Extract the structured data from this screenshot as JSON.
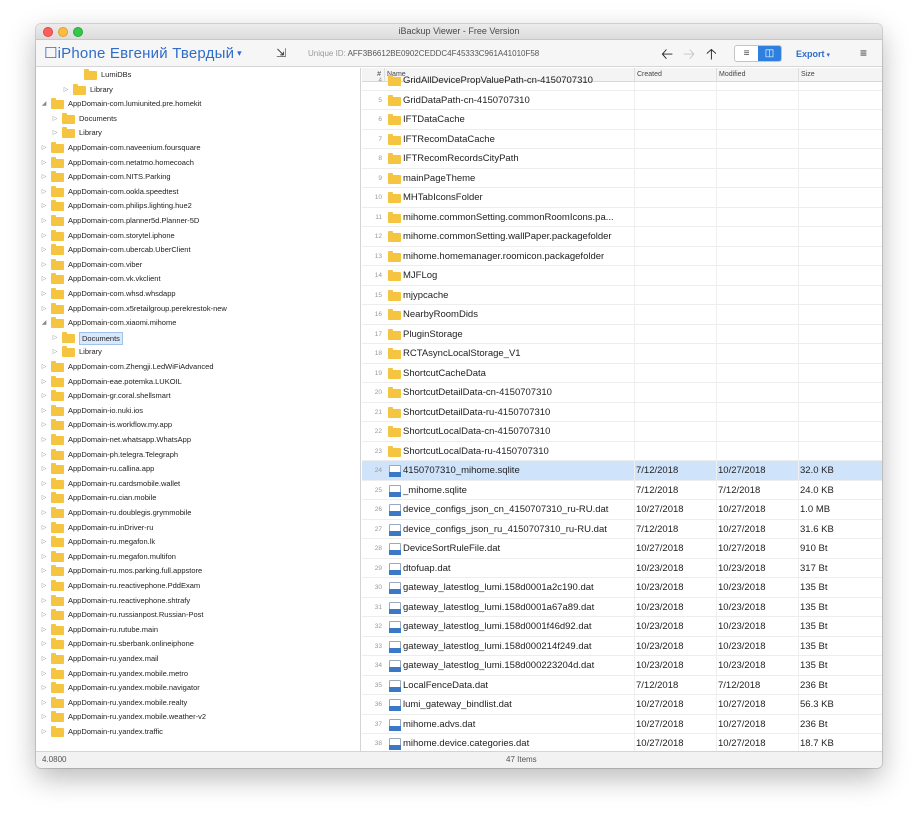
{
  "window": {
    "title": "iBackup Viewer - Free Version"
  },
  "toolbar": {
    "device_name": "☐iPhone Евгений Твердый",
    "device_caret": "▾",
    "tree_icon": "⇲",
    "unique_id_label": "Unique ID:",
    "unique_id_value": "AFF3B6612BE0902CEDDC4F45333C961A41010F58",
    "back": "🡠",
    "forward": "🡢",
    "up": "🡡",
    "view_list": "≡",
    "view_columns": "◫",
    "export_label": "Export",
    "export_caret": "▾",
    "menu": "≡"
  },
  "sidebar": {
    "items": [
      {
        "label": "LumiDBs",
        "level": 3,
        "disclosure": ""
      },
      {
        "label": "Library",
        "level": 2,
        "disclosure": "closed"
      },
      {
        "label": "AppDomain-com.lumiunited.pre.homekit",
        "level": 0,
        "disclosure": "open"
      },
      {
        "label": "Documents",
        "level": 1,
        "disclosure": "closed"
      },
      {
        "label": "Library",
        "level": 1,
        "disclosure": "closed"
      },
      {
        "label": "AppDomain-com.naveenium.foursquare",
        "level": 0,
        "disclosure": "closed"
      },
      {
        "label": "AppDomain-com.netatmo.homecoach",
        "level": 0,
        "disclosure": "closed"
      },
      {
        "label": "AppDomain-com.NITS.Parking",
        "level": 0,
        "disclosure": "closed"
      },
      {
        "label": "AppDomain-com.ookla.speedtest",
        "level": 0,
        "disclosure": "closed"
      },
      {
        "label": "AppDomain-com.philips.lighting.hue2",
        "level": 0,
        "disclosure": "closed"
      },
      {
        "label": "AppDomain-com.planner5d.Planner-5D",
        "level": 0,
        "disclosure": "closed"
      },
      {
        "label": "AppDomain-com.storytel.iphone",
        "level": 0,
        "disclosure": "closed"
      },
      {
        "label": "AppDomain-com.ubercab.UberClient",
        "level": 0,
        "disclosure": "closed"
      },
      {
        "label": "AppDomain-com.viber",
        "level": 0,
        "disclosure": "closed"
      },
      {
        "label": "AppDomain-com.vk.vkclient",
        "level": 0,
        "disclosure": "closed"
      },
      {
        "label": "AppDomain-com.whsd.whsdapp",
        "level": 0,
        "disclosure": "closed"
      },
      {
        "label": "AppDomain-com.x5retailgroup.perekrestok-new",
        "level": 0,
        "disclosure": "closed"
      },
      {
        "label": "AppDomain-com.xiaomi.mihome",
        "level": 0,
        "disclosure": "open"
      },
      {
        "label": "Documents",
        "level": 1,
        "disclosure": "closed",
        "selected": true
      },
      {
        "label": "Library",
        "level": 1,
        "disclosure": "closed"
      },
      {
        "label": "AppDomain-com.Zhengji.LedWiFiAdvanced",
        "level": 0,
        "disclosure": "closed"
      },
      {
        "label": "AppDomain-eae.potemka.LUKOIL",
        "level": 0,
        "disclosure": "closed"
      },
      {
        "label": "AppDomain-gr.coral.shellsmart",
        "level": 0,
        "disclosure": "closed"
      },
      {
        "label": "AppDomain-io.nuki.ios",
        "level": 0,
        "disclosure": "closed"
      },
      {
        "label": "AppDomain-is.workflow.my.app",
        "level": 0,
        "disclosure": "closed"
      },
      {
        "label": "AppDomain-net.whatsapp.WhatsApp",
        "level": 0,
        "disclosure": "closed"
      },
      {
        "label": "AppDomain-ph.telegra.Telegraph",
        "level": 0,
        "disclosure": "closed"
      },
      {
        "label": "AppDomain-ru.callina.app",
        "level": 0,
        "disclosure": "closed"
      },
      {
        "label": "AppDomain-ru.cardsmobile.wallet",
        "level": 0,
        "disclosure": "closed"
      },
      {
        "label": "AppDomain-ru.cian.mobile",
        "level": 0,
        "disclosure": "closed"
      },
      {
        "label": "AppDomain-ru.doublegis.grymmobile",
        "level": 0,
        "disclosure": "closed"
      },
      {
        "label": "AppDomain-ru.inDriver-ru",
        "level": 0,
        "disclosure": "closed"
      },
      {
        "label": "AppDomain-ru.megafon.lk",
        "level": 0,
        "disclosure": "closed"
      },
      {
        "label": "AppDomain-ru.megafon.multifon",
        "level": 0,
        "disclosure": "closed"
      },
      {
        "label": "AppDomain-ru.mos.parking.full.appstore",
        "level": 0,
        "disclosure": "closed"
      },
      {
        "label": "AppDomain-ru.reactivephone.PddExam",
        "level": 0,
        "disclosure": "closed"
      },
      {
        "label": "AppDomain-ru.reactivephone.shtrafy",
        "level": 0,
        "disclosure": "closed"
      },
      {
        "label": "AppDomain-ru.russianpost.Russian-Post",
        "level": 0,
        "disclosure": "closed"
      },
      {
        "label": "AppDomain-ru.rutube.main",
        "level": 0,
        "disclosure": "closed"
      },
      {
        "label": "AppDomain-ru.sberbank.onlineiphone",
        "level": 0,
        "disclosure": "closed"
      },
      {
        "label": "AppDomain-ru.yandex.mail",
        "level": 0,
        "disclosure": "closed"
      },
      {
        "label": "AppDomain-ru.yandex.mobile.metro",
        "level": 0,
        "disclosure": "closed"
      },
      {
        "label": "AppDomain-ru.yandex.mobile.navigator",
        "level": 0,
        "disclosure": "closed"
      },
      {
        "label": "AppDomain-ru.yandex.mobile.realty",
        "level": 0,
        "disclosure": "closed"
      },
      {
        "label": "AppDomain-ru.yandex.mobile.weather-v2",
        "level": 0,
        "disclosure": "closed"
      },
      {
        "label": "AppDomain-ru.yandex.traffic",
        "level": 0,
        "disclosure": "closed"
      }
    ]
  },
  "table": {
    "headers": {
      "num": "#",
      "name": "Name",
      "created": "Created",
      "modified": "Modified",
      "size": "Size"
    },
    "rows": [
      {
        "num": "4",
        "type": "folder",
        "name": "GridAllDevicePropValuePath-cn-4150707310",
        "created": "",
        "modified": "",
        "size": ""
      },
      {
        "num": "5",
        "type": "folder",
        "name": "GridDataPath-cn-4150707310",
        "created": "",
        "modified": "",
        "size": ""
      },
      {
        "num": "6",
        "type": "folder",
        "name": "IFTDataCache",
        "created": "",
        "modified": "",
        "size": ""
      },
      {
        "num": "7",
        "type": "folder",
        "name": "IFTRecomDataCache",
        "created": "",
        "modified": "",
        "size": ""
      },
      {
        "num": "8",
        "type": "folder",
        "name": "IFTRecomRecordsCityPath",
        "created": "",
        "modified": "",
        "size": ""
      },
      {
        "num": "9",
        "type": "folder",
        "name": "mainPageTheme",
        "created": "",
        "modified": "",
        "size": ""
      },
      {
        "num": "10",
        "type": "folder",
        "name": "MHTabIconsFolder",
        "created": "",
        "modified": "",
        "size": ""
      },
      {
        "num": "11",
        "type": "folder",
        "name": "mihome.commonSetting.commonRoomIcons.pa...",
        "created": "",
        "modified": "",
        "size": ""
      },
      {
        "num": "12",
        "type": "folder",
        "name": "mihome.commonSetting.wallPaper.packagefolder",
        "created": "",
        "modified": "",
        "size": ""
      },
      {
        "num": "13",
        "type": "folder",
        "name": "mihome.homemanager.roomicon.packagefolder",
        "created": "",
        "modified": "",
        "size": ""
      },
      {
        "num": "14",
        "type": "folder",
        "name": "MJFLog",
        "created": "",
        "modified": "",
        "size": ""
      },
      {
        "num": "15",
        "type": "folder",
        "name": "mjypcache",
        "created": "",
        "modified": "",
        "size": ""
      },
      {
        "num": "16",
        "type": "folder",
        "name": "NearbyRoomDids",
        "created": "",
        "modified": "",
        "size": ""
      },
      {
        "num": "17",
        "type": "folder",
        "name": "PluginStorage",
        "created": "",
        "modified": "",
        "size": ""
      },
      {
        "num": "18",
        "type": "folder",
        "name": "RCTAsyncLocalStorage_V1",
        "created": "",
        "modified": "",
        "size": ""
      },
      {
        "num": "19",
        "type": "folder",
        "name": "ShortcutCacheData",
        "created": "",
        "modified": "",
        "size": ""
      },
      {
        "num": "20",
        "type": "folder",
        "name": "ShortcutDetailData-cn-4150707310",
        "created": "",
        "modified": "",
        "size": ""
      },
      {
        "num": "21",
        "type": "folder",
        "name": "ShortcutDetailData-ru-4150707310",
        "created": "",
        "modified": "",
        "size": ""
      },
      {
        "num": "22",
        "type": "folder",
        "name": "ShortcutLocalData-cn-4150707310",
        "created": "",
        "modified": "",
        "size": ""
      },
      {
        "num": "23",
        "type": "folder",
        "name": "ShortcutLocalData-ru-4150707310",
        "created": "",
        "modified": "",
        "size": ""
      },
      {
        "num": "24",
        "type": "file",
        "name": "4150707310_mihome.sqlite",
        "created": "7/12/2018",
        "modified": "10/27/2018",
        "size": "32.0 KB",
        "selected": true
      },
      {
        "num": "25",
        "type": "file",
        "name": "_mihome.sqlite",
        "created": "7/12/2018",
        "modified": "7/12/2018",
        "size": "24.0 KB"
      },
      {
        "num": "26",
        "type": "file",
        "name": "device_configs_json_cn_4150707310_ru-RU.dat",
        "created": "10/27/2018",
        "modified": "10/27/2018",
        "size": "1.0 MB"
      },
      {
        "num": "27",
        "type": "file",
        "name": "device_configs_json_ru_4150707310_ru-RU.dat",
        "created": "7/12/2018",
        "modified": "10/27/2018",
        "size": "31.6 KB"
      },
      {
        "num": "28",
        "type": "file",
        "name": "DeviceSortRuleFile.dat",
        "created": "10/27/2018",
        "modified": "10/27/2018",
        "size": "910 Bt"
      },
      {
        "num": "29",
        "type": "file",
        "name": "dtofuap.dat",
        "created": "10/23/2018",
        "modified": "10/23/2018",
        "size": "317 Bt"
      },
      {
        "num": "30",
        "type": "file",
        "name": "gateway_latestlog_lumi.158d0001a2c190.dat",
        "created": "10/23/2018",
        "modified": "10/23/2018",
        "size": "135 Bt"
      },
      {
        "num": "31",
        "type": "file",
        "name": "gateway_latestlog_lumi.158d0001a67a89.dat",
        "created": "10/23/2018",
        "modified": "10/23/2018",
        "size": "135 Bt"
      },
      {
        "num": "32",
        "type": "file",
        "name": "gateway_latestlog_lumi.158d0001f46d92.dat",
        "created": "10/23/2018",
        "modified": "10/23/2018",
        "size": "135 Bt"
      },
      {
        "num": "33",
        "type": "file",
        "name": "gateway_latestlog_lumi.158d000214f249.dat",
        "created": "10/23/2018",
        "modified": "10/23/2018",
        "size": "135 Bt"
      },
      {
        "num": "34",
        "type": "file",
        "name": "gateway_latestlog_lumi.158d000223204d.dat",
        "created": "10/23/2018",
        "modified": "10/23/2018",
        "size": "135 Bt"
      },
      {
        "num": "35",
        "type": "file",
        "name": "LocalFenceData.dat",
        "created": "7/12/2018",
        "modified": "7/12/2018",
        "size": "236 Bt"
      },
      {
        "num": "36",
        "type": "file",
        "name": "lumi_gateway_bindlist.dat",
        "created": "10/27/2018",
        "modified": "10/27/2018",
        "size": "56.3 KB"
      },
      {
        "num": "37",
        "type": "file",
        "name": "mihome.advs.dat",
        "created": "10/27/2018",
        "modified": "10/27/2018",
        "size": "236 Bt"
      },
      {
        "num": "38",
        "type": "file",
        "name": "mihome.device.categories.dat",
        "created": "10/27/2018",
        "modified": "10/27/2018",
        "size": "18.7 KB"
      }
    ]
  },
  "status": {
    "left": "4.0800",
    "center": "47 Items"
  },
  "colors": {
    "accent": "#2f6cc9",
    "selection": "#cfe3fb",
    "folder": "#f5c542"
  }
}
